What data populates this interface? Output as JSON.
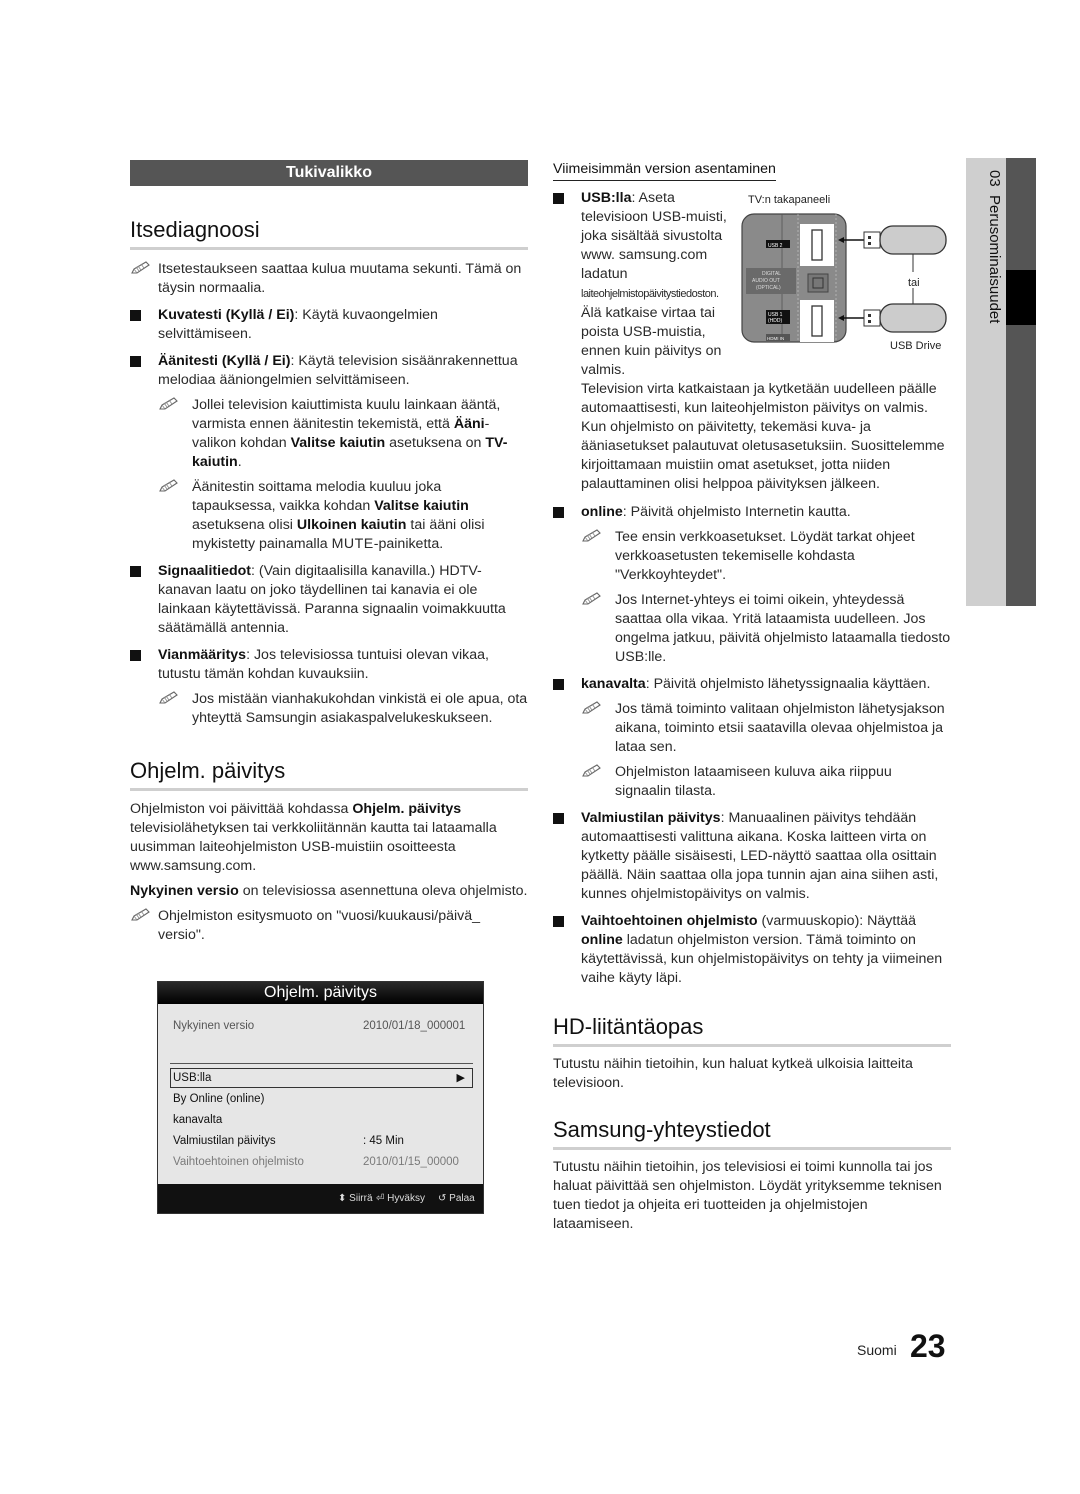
{
  "side_tab": {
    "chapter": "03",
    "title": "Perusominaisuudet"
  },
  "left": {
    "banner": "Tukivalikko",
    "itsediagnoosi": {
      "heading": "Itsediagnoosi",
      "note1": "Itsetestaukseen saattaa kulua muutama sekunti. Tämä on täysin normaalia.",
      "kuvatesti": {
        "term": "Kuvatesti (Kyllä / Ei)",
        "text": ": Käytä kuvaongelmien selvittämiseen."
      },
      "aanitesti": {
        "term": "Äänitesti (Kyllä / Ei)",
        "text": ": Käytä television sisäänrakennettua melodiaa ääniongelmien selvittämiseen."
      },
      "aani_note1": {
        "t1": "Jollei television kaiuttimista kuulu lainkaan ääntä, varmista ennen äänitestin tekemistä, että ",
        "b1": "Ääni",
        "t2": "-valikon kohdan ",
        "b2": "Valitse kaiutin",
        "t3": " asetuksena on ",
        "b3": "TV-kaiutin",
        "t4": "."
      },
      "aani_note2": {
        "t1": "Äänitestin soittama melodia kuuluu joka tapauksessa, vaikka kohdan ",
        "b1": "Valitse kaiutin",
        "t2": " asetuksena olisi ",
        "b2": "Ulkoinen kaiutin",
        "t3": " tai ääni olisi mykistetty painamalla ",
        "m": "MUTE",
        "t4": "-painiketta."
      },
      "signaali": {
        "term": "Signaalitiedot",
        "text": ": (Vain digitaalisilla kanavilla.) HDTV-kanavan laatu on joko täydellinen tai kanavia ei ole lainkaan käytettävissä. Paranna signaalin voimakkuutta säätämällä antennia."
      },
      "vianmaaritys": {
        "term": "Vianmääritys",
        "text": ": Jos televisiossa tuntuisi olevan vikaa, tutustu tämän kohdan kuvauksiin."
      },
      "vian_note": "Jos mistään vianhakukohdan vinkistä ei ole apua, ota yhteyttä Samsungin asiakaspalvelukeskukseen."
    },
    "ohjelm": {
      "heading": "Ohjelm. päivitys",
      "p1": {
        "t1": "Ohjelmiston voi päivittää kohdassa ",
        "b1": "Ohjelm. päivitys",
        "t2": " televisiolähetyksen tai verkkoliitännän kautta tai lataamalla uusimman laiteohjelmiston USB-muistiin osoitteesta www.samsung.com."
      },
      "p2": {
        "b1": "Nykyinen versio",
        "t1": " on televisiossa asennettuna oleva ohjelmisto."
      },
      "note": "Ohjelmiston esitysmuoto on \"vuosi/kuukausi/päivä_ versio\"."
    }
  },
  "menu": {
    "title": "Ohjelm. päivitys",
    "current_label": "Nykyinen versio",
    "current_value": "2010/01/18_000001",
    "rows": [
      {
        "label": "USB:lla",
        "value": ""
      },
      {
        "label": "By Online (online)",
        "value": ""
      },
      {
        "label": "kanavalta",
        "value": ""
      },
      {
        "label": "Valmiustilan päivitys",
        "value": ": 45 Min"
      },
      {
        "label": "Vaihtoehtoinen ohjelmisto",
        "value": "2010/01/15_00000"
      }
    ],
    "footer": {
      "move": "Siirrä",
      "ok": "Hyväksy",
      "back": "Palaa"
    }
  },
  "right": {
    "subheading": "Viimeisimmän version asentaminen",
    "usb": {
      "term": "USB:lla",
      "text": ": Aseta televisioon USB-muisti, joka sisältää sivustolta www. samsung.com ladatun",
      "small": "laiteohjelmistopäivitystiedoston.",
      "text2": "Älä katkaise virtaa tai poista USB-muistia, ennen kuin päivitys on valmis."
    },
    "usb_para": "Television virta katkaistaan ja kytketään uudelleen päälle automaattisesti, kun laiteohjelmiston päivitys on valmis. Kun ohjelmisto on päivitetty, tekemäsi kuva- ja ääniasetukset palautuvat oletusasetuksiin. Suosittelemme kirjoittamaan muistiin omat asetukset, jotta niiden palauttaminen olisi helppoa päivityksen jälkeen.",
    "diagram": {
      "panel_label": "TV:n takapaneeli",
      "or_label": "tai",
      "drive_label": "USB Drive",
      "port1": "USB 2",
      "port2": "DIGITAL AUDIO OUT (OPTICAL)",
      "port3": "USB 1 (HDD)",
      "port4": "HDMI IN"
    },
    "online": {
      "term": "online",
      "text": ": Päivitä ohjelmisto Internetin kautta."
    },
    "online_note1": "Tee ensin verkkoasetukset. Löydät tarkat ohjeet verkkoasetusten tekemiselle kohdasta \"Verkkoyhteydet\".",
    "online_note2": "Jos Internet-yhteys ei toimi oikein, yhteydessä saattaa olla vikaa. Yritä lataamista uudelleen. Jos ongelma jatkuu, päivitä ohjelmisto lataamalla tiedosto USB:lle.",
    "kanavalta": {
      "term": "kanavalta",
      "text": ": Päivitä ohjelmisto lähetyssignaalia käyttäen."
    },
    "kanava_note1": "Jos tämä toiminto valitaan ohjelmiston lähetysjakson aikana, toiminto etsii saatavilla olevaa ohjelmistoa ja lataa sen.",
    "kanava_note2": "Ohjelmiston lataamiseen kuluva aika riippuu signaalin tilasta.",
    "valmius": {
      "term": "Valmiustilan päivitys",
      "text": ": Manuaalinen päivitys tehdään automaattisesti valittuna aikana. Koska laitteen virta on kytketty päälle sisäisesti, LED-näyttö saattaa olla osittain päällä. Näin saattaa olla jopa tunnin ajan aina siihen asti, kunnes ohjelmistopäivitys on valmis."
    },
    "vaihto": {
      "term": "Vaihtoehtoinen ohjelmisto",
      "t1": " (varmuuskopio): Näyttää ",
      "b1": "online",
      "t2": " ladatun ohjelmiston version. Tämä toiminto on käytettävissä, kun ohjelmistopäivitys on tehty ja viimeinen vaihe käyty läpi."
    },
    "hd": {
      "heading": "HD-liitäntäopas",
      "text": "Tutustu näihin tietoihin, kun haluat kytkeä ulkoisia laitteita televisioon."
    },
    "samsung": {
      "heading": "Samsung-yhteystiedot",
      "text": "Tutustu näihin tietoihin, jos televisiosi ei toimi kunnolla tai jos haluat päivittää sen ohjelmiston. Löydät yrityksemme teknisen tuen tiedot ja ohjeita eri tuotteiden ja ohjelmistojen lataamiseen."
    }
  },
  "footer": {
    "language": "Suomi",
    "page": "23"
  }
}
